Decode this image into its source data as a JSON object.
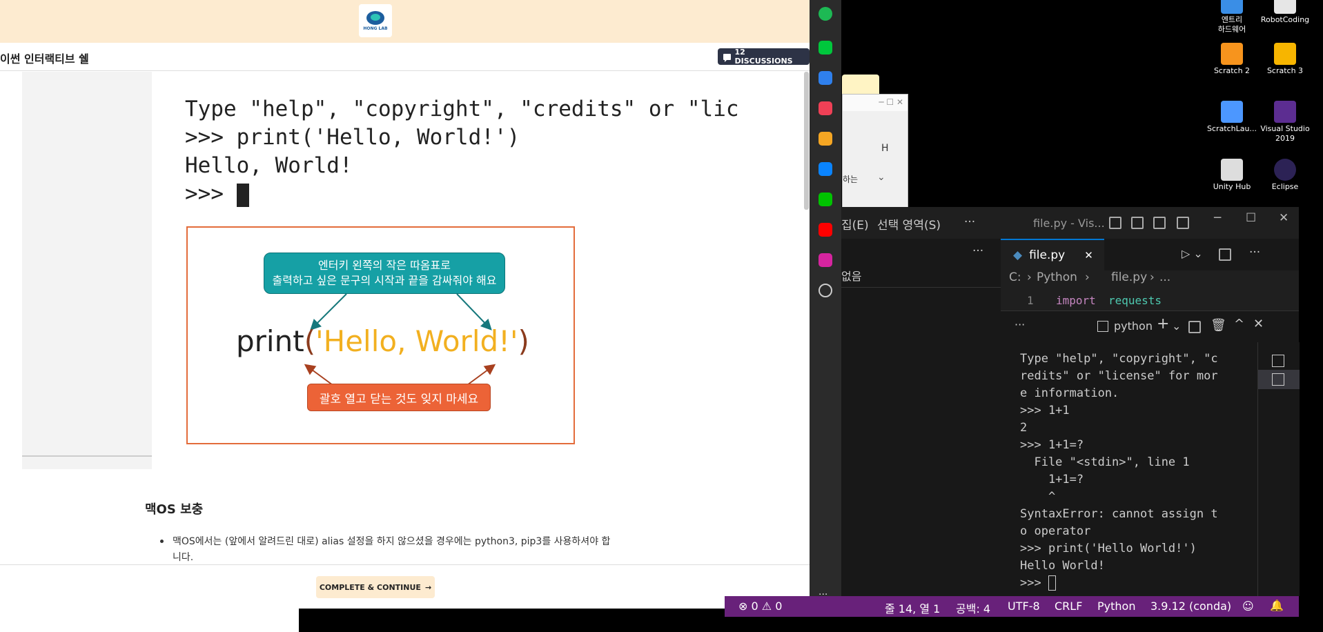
{
  "course": {
    "logo_text": "HONG LAB",
    "lesson_title": "이썬 인터랙티브 쉘",
    "discussions": "12 DISCUSSIONS",
    "terminal_lines": [
      "Type \"help\", \"copyright\", \"credits\" or \"lic",
      ">>> print('Hello, World!')",
      "Hello, World!",
      ">>> "
    ],
    "diagram": {
      "callout_top_line1": "엔터키 왼쪽의 작은 따옴표로",
      "callout_top_line2": "출력하고 싶은 문구의 시작과 끝을 감싸줘야 해요",
      "code_print": "print",
      "code_open": "(",
      "code_string": "'Hello, World!'",
      "code_close": ")",
      "callout_bottom": "괄호 열고 닫는 것도 잊지 마세요"
    },
    "section_heading": "맥OS 보충",
    "bullet_text": "맥OS에서는 (앞에서 알려드린 대로) alias 설정을 하지 않으셨을 경우에는 python3, pip3를 사용하셔야 합니다.",
    "continue_label": "COMPLETE & CONTINUE",
    "continue_arrow": "→"
  },
  "dock": {
    "icons": [
      {
        "name": "circle-app-icon",
        "color": "#1db954"
      },
      {
        "name": "chat-app-icon",
        "color": "#00c73c"
      },
      {
        "name": "briefcase-icon",
        "color": "#2f80ed"
      },
      {
        "name": "pocket-icon",
        "color": "#ef4056"
      },
      {
        "name": "star-icon",
        "color": "#f5a623"
      },
      {
        "name": "edge-icon",
        "color": "#0a84ff"
      },
      {
        "name": "line-icon",
        "color": "#00c300"
      },
      {
        "name": "youtube-icon",
        "color": "#ff0000"
      },
      {
        "name": "instagram-icon",
        "color": "#d6249f"
      },
      {
        "name": "add-icon",
        "color": "#444444"
      }
    ],
    "more": "..."
  },
  "desktop": {
    "icons": [
      {
        "label1": "엔트리",
        "label2": "하드웨어",
        "color": "#3a8ee6"
      },
      {
        "label1": "RobotCoding",
        "label2": "",
        "color": "#e6e6e6"
      },
      {
        "label1": "Scratch 2",
        "label2": "",
        "color": "#f7941d"
      },
      {
        "label1": "Scratch 3",
        "label2": "",
        "color": "#f7b500"
      },
      {
        "label1": "ScratchLau...",
        "label2": "",
        "color": "#4c97ff"
      },
      {
        "label1": "Visual Studio",
        "label2": "2019",
        "color": "#5c2d91"
      },
      {
        "label1": "Unity Hub",
        "label2": "",
        "color": "#dddddd"
      },
      {
        "label1": "Eclipse",
        "label2": "",
        "color": "#2c2255"
      }
    ]
  },
  "bg_window": {
    "col_label": "H",
    "text": "하는"
  },
  "vscode": {
    "menu_edit": "집(E)",
    "menu_selection": "선택 영역(S)",
    "menu_more": "···",
    "window_title": "file.py - Vis...",
    "left_more": "···",
    "left_item": "없음",
    "tab_label": "file.py",
    "tab_close": "✕",
    "breadcrumb": [
      "C:",
      "Python",
      "file.py",
      "..."
    ],
    "line_number": "1",
    "code_kw": "import",
    "code_mod": "requests",
    "panel_more": "···",
    "terminal_name": "python",
    "terminal_lines": [
      "Type \"help\", \"copyright\", \"c",
      "redits\" or \"license\" for mor",
      "e information.",
      ">>> 1+1",
      "2",
      ">>> 1+1=?",
      "  File \"<stdin>\", line 1",
      "    1+1=?",
      "    ^",
      "SyntaxError: cannot assign t",
      "o operator",
      ">>> print('Hello World!')",
      "Hello World!",
      ">>> "
    ],
    "status": {
      "warnings": "⊗ 0 ⚠ 0",
      "position": "줄 14, 열 1",
      "spaces": "공백: 4",
      "encoding": "UTF-8",
      "eol": "CRLF",
      "language": "Python",
      "interpreter": "3.9.12 (conda)"
    }
  }
}
